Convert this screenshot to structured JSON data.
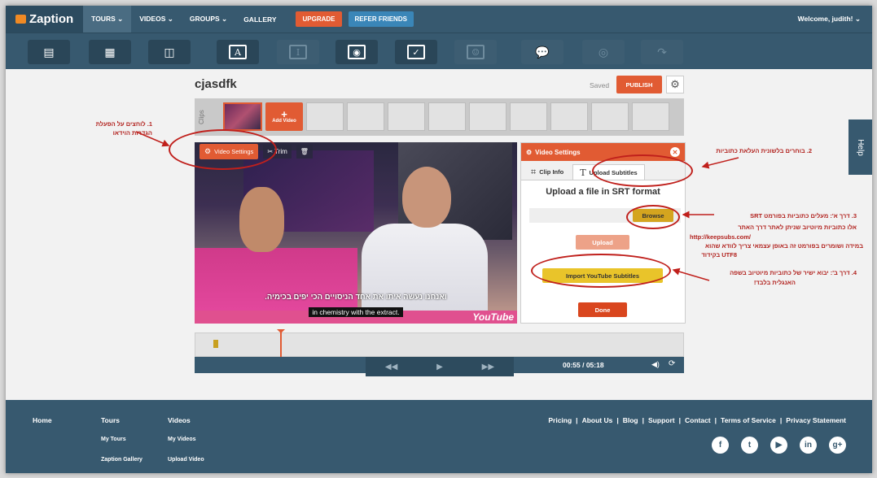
{
  "nav": {
    "logo": "Zaption",
    "items": [
      {
        "label": "TOURS ⌄"
      },
      {
        "label": "VIDEOS ⌄"
      },
      {
        "label": "GROUPS ⌄"
      },
      {
        "label": "GALLERY"
      }
    ],
    "upgrade": "UPGRADE",
    "refer": "REFER FRIENDS",
    "welcome": "Welcome, judith! ⌄"
  },
  "toolbar": {
    "tools": [
      {
        "icon": "slide-icon",
        "glyph": "▤"
      },
      {
        "icon": "image-icon",
        "glyph": "▦"
      },
      {
        "icon": "image-stack-icon",
        "glyph": "◫"
      },
      {
        "icon": "text-icon",
        "glyph": "A"
      },
      {
        "icon": "text-box-icon",
        "glyph": "I"
      },
      {
        "icon": "radio-question-icon",
        "glyph": "◉"
      },
      {
        "icon": "checkbox-question-icon",
        "glyph": "✓"
      },
      {
        "icon": "smiley-icon",
        "glyph": "☺"
      },
      {
        "icon": "chat-icon",
        "glyph": "💬"
      },
      {
        "icon": "replay-icon",
        "glyph": "◎"
      },
      {
        "icon": "jump-icon",
        "glyph": "↷"
      }
    ]
  },
  "project": {
    "title": "cjasdfk",
    "saved": "Saved",
    "publish": "PUBLISH"
  },
  "clips": {
    "label": "Clips",
    "add_video": "Add Video"
  },
  "video": {
    "settings_btn": "Video Settings",
    "trim": "Trim",
    "subtitle_he": ".ואנחנו נעשה איתו את אחד הניסויים הכי יפים בכימיה",
    "subtitle_en": "in chemistry with the extract.",
    "youtube": "YouTube"
  },
  "panel": {
    "title": "Video Settings",
    "tab_clip": "Clip Info",
    "tab_subtitles": "Upload Subtitles",
    "upload_title": "Upload a file in SRT format",
    "browse": "Browse",
    "upload": "Upload",
    "import": "Import YouTube Subtitles",
    "done": "Done"
  },
  "help": "Help",
  "player": {
    "time": "00:55 / 05:18"
  },
  "annotations": {
    "n1": "1.    לוחצים על הפעלת\nהגדרות הוידאו",
    "n2": "2.    בוחרים בלשונית העלאת כתוביות",
    "n3a": "3.   דרך א': מעלים כתוביות בפורמט      SRT",
    "n3b": "אלו כתוביות מיוטיוב שניתן לאתר דרך האתר",
    "n3url": "http://keepsubs.com/",
    "n3c": "במידה ושומרים בפורמט זה באופן עצמאי צריך לוודא שהוא",
    "n3d": "UTF8   בקידוד",
    "n4a": "4.    דרך ב': יבוא ישיר של כתוביות מיוטיוב בשפה",
    "n4b": "האנגלית בלבד!"
  },
  "footer": {
    "col1": "Home",
    "col2": "Tours",
    "col2_items": [
      "My Tours",
      "Zaption Gallery"
    ],
    "col3": "Videos",
    "col3_items": [
      "My Videos",
      "Upload Video"
    ],
    "links": [
      "Pricing",
      "About Us",
      "Blog",
      "Support",
      "Contact",
      "Terms of Service",
      "Privacy Statement"
    ],
    "social": [
      {
        "icon": "facebook-icon",
        "glyph": "f"
      },
      {
        "icon": "twitter-icon",
        "glyph": "t"
      },
      {
        "icon": "youtube-icon",
        "glyph": "▶"
      },
      {
        "icon": "linkedin-icon",
        "glyph": "in"
      },
      {
        "icon": "googleplus-icon",
        "glyph": "g+"
      }
    ]
  },
  "colors": {
    "nav": "#37596f",
    "accent": "#e15b33",
    "annotation": "#b2231f"
  }
}
